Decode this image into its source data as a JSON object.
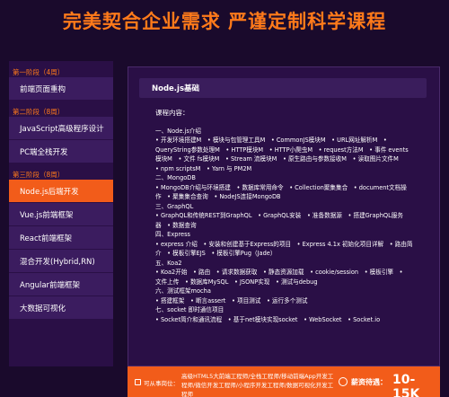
{
  "title": "完美契合企业需求 严谨定制科学课程",
  "sidebar": {
    "stage1": {
      "label": "第一阶段（4周）",
      "items": [
        "前端页面重构"
      ]
    },
    "stage2": {
      "label": "第二阶段（8周）",
      "items": [
        "JavaScript高级程序设计",
        "PC端全栈开发"
      ]
    },
    "stage3": {
      "label": "第三阶段（8周）",
      "items": [
        "Node.js后端开发",
        "Vue.js前端框架",
        "React前端框架",
        "混合开发(Hybrid,RN)",
        "Angular前端框架",
        "大数据可视化"
      ]
    }
  },
  "panel": {
    "heading": "Node.js基础",
    "content_label": "课程内容：",
    "lines": [
      "一、Node.js介绍",
      "• 开发环境搭建M　• 模块与包管理工具M　• CommonJS模块M　• URL网址解析M　•",
      "QueryString参数处理M　• HTTP模块M　• HTTP小爬虫M　• request方法M　• 事件 events",
      "模块M　• 文件 fs模块M　• Stream 流模块M　• 原生路由与参数接收M　• 读取图片文件M",
      "• npm scriptsM　• Yarn 与 PM2M",
      "二、MongoDB",
      "• MongoDB介绍与环境搭建　• 数据库常用命令　• Collection聚集集合　• document文档操",
      "作　• 聚集集合查询　• NodeJS连接MongoDB",
      "三、GraphQL",
      "• GraphQL和传统REST到GraphQL　• GraphQL安装　• 准备数据源　• 搭建GraphQL服务",
      "器　• 数据查询",
      "四、Express",
      "• express 介绍　• 安装和创建基于Express的项目　• Express 4.1x 初始化项目详解　• 路由简",
      "介　• 模板引擎EJS　• 模板引擎Pug（Jade）",
      "五、Koa2",
      "• Koa2开始　• 路由　• 请求数据获取　• 静态资源加载　• cookie/session　• 模板引擎　•",
      "文件上传　• 数据库MySQL　• JSONP实现　• 测试与debug",
      "六、测试框架mocha",
      "• 搭建框架　• 断言assert　• 项目测试　• 运行多个测试",
      "七、socket 即时通信项目",
      "• Socket简介和通讯流程　• 基于net模块实现socket　• WebSocket　• Socket.io"
    ]
  },
  "bottom": {
    "job_label": "可从事岗位：",
    "job_desc": "高级HTML5大前端工程师/全栈工程师/移动前端App开发工程师/微信开发工程师/小程序开发工程师/数据可视化开发工程师",
    "salary_label": "薪资待遇：",
    "salary_value": "10-15K"
  },
  "colors": {
    "accent": "#f25c1a",
    "title": "#ff7a1a",
    "bg": "#1a0a2c",
    "panel": "#2a0f46"
  }
}
